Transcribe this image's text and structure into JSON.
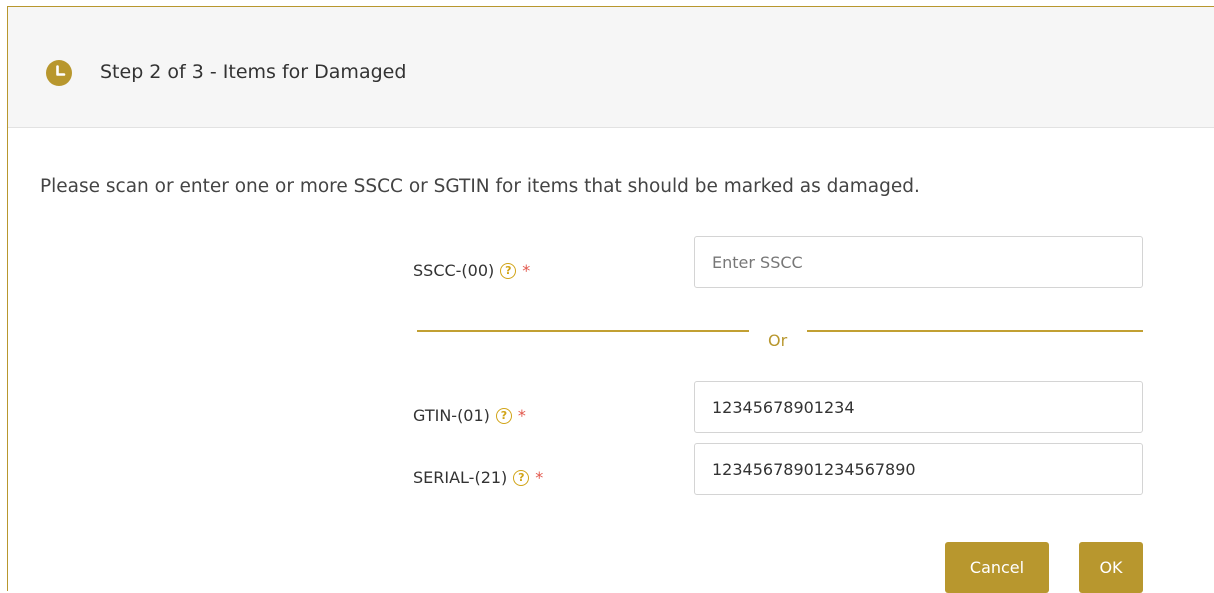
{
  "dialog": {
    "title": "Step 2 of 3 - Items for Damaged",
    "header_icon": "clock-icon",
    "instructions": "Please scan or enter one or more SSCC or SGTIN for items that should be marked as damaged."
  },
  "form": {
    "sscc": {
      "label": "SSCC-(00)",
      "value": "",
      "placeholder": "Enter SSCC",
      "required_mark": "*",
      "help_icon": "question-circle-icon"
    },
    "separator": "Or",
    "gtin": {
      "label": "GTIN-(01)",
      "value": "12345678901234",
      "required_mark": "*",
      "help_icon": "question-circle-icon"
    },
    "serial": {
      "label": "SERIAL-(21)",
      "value": "12345678901234567890",
      "required_mark": "*",
      "help_icon": "question-circle-icon"
    }
  },
  "buttons": {
    "cancel": "Cancel",
    "ok": "OK"
  },
  "colors": {
    "accent": "#b8972e",
    "required": "#e2574c",
    "header_bg": "#f6f6f6"
  }
}
